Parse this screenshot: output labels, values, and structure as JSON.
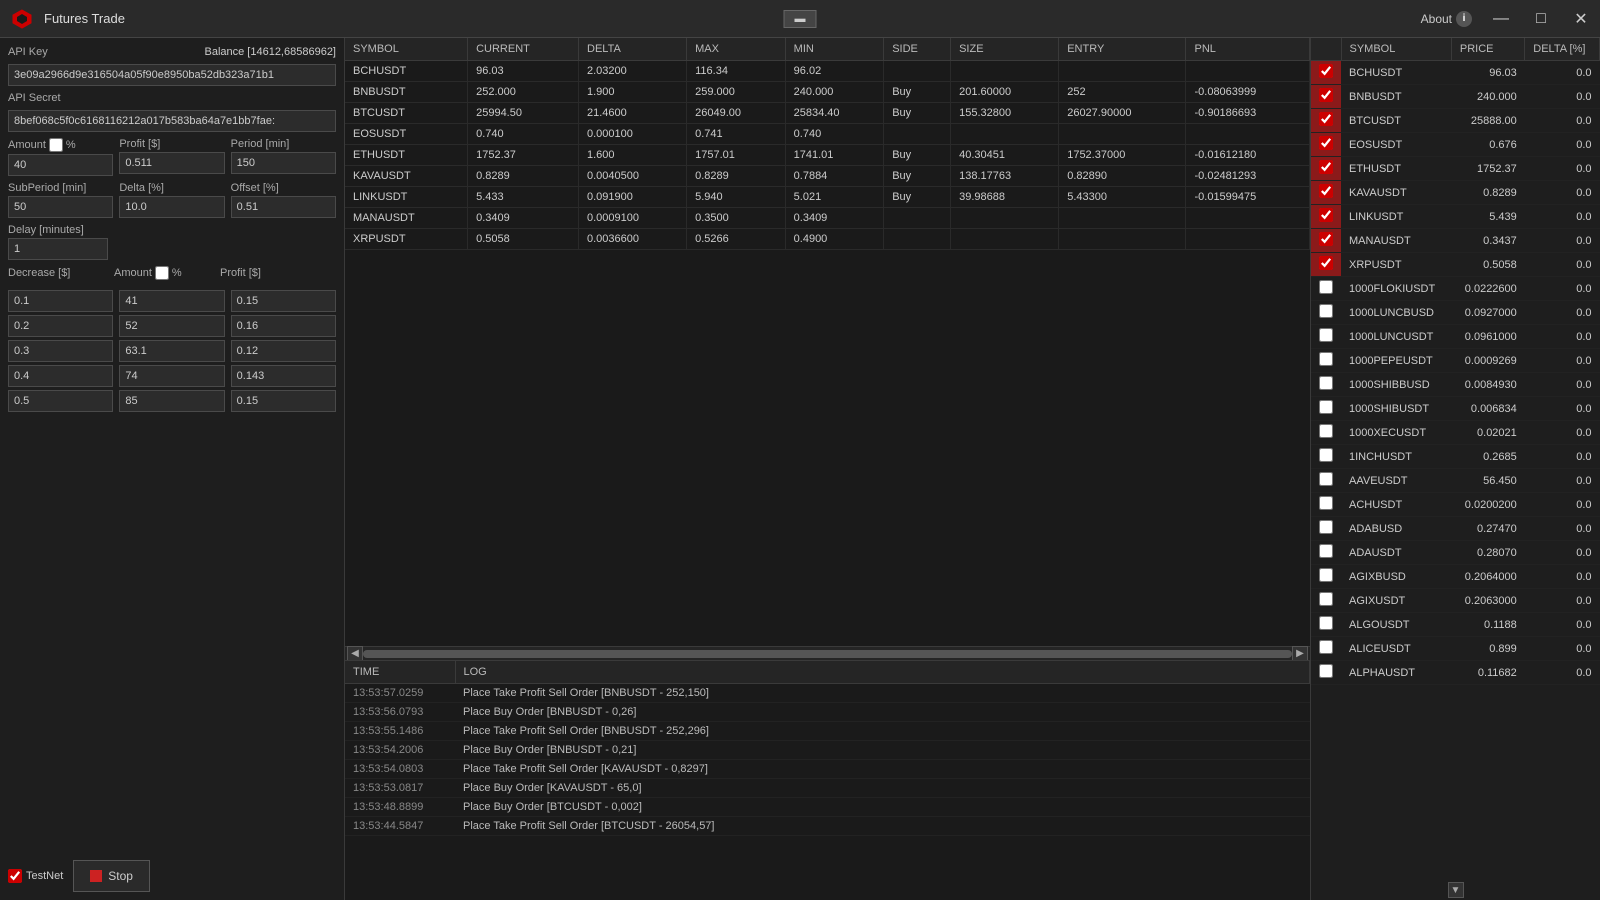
{
  "titlebar": {
    "logo": "◆",
    "title": "Futures Trade",
    "center_btn": "▬",
    "about_label": "About",
    "about_icon": "i",
    "minimize": "—",
    "restore": "□",
    "close": "✕"
  },
  "left": {
    "api_key_label": "API Key",
    "balance_label": "Balance [14612,68586962]",
    "api_key_value": "3e09a2966d9e316504a05f90e8950ba52db323a71b1",
    "api_secret_label": "API Secret",
    "api_secret_value": "8bef068c5f0c6168116212a017b583ba64a7e1bb7fae:",
    "amount_label": "Amount",
    "amount_has_checkbox": true,
    "amount_percent_label": "%",
    "amount_value": "40",
    "profit_label": "Profit [$]",
    "profit_value": "0.511",
    "period_label": "Period [min]",
    "period_value": "150",
    "subperiod_label": "SubPeriod [min]",
    "subperiod_value": "50",
    "delta_label": "Delta [%]",
    "delta_value": "10.0",
    "offset_label": "Offset [%]",
    "offset_value": "0.51",
    "delay_label": "Delay [minutes]",
    "delay_value": "1",
    "decrease_header": "Decrease [$]",
    "amount_col_header": "Amount",
    "profit_col_header": "Profit [$]",
    "decrease_has_checkbox": false,
    "amount_has_checkbox2": true,
    "decrease_rows": [
      {
        "decrease": "0.1",
        "amount": "41",
        "profit": "0.15"
      },
      {
        "decrease": "0.2",
        "amount": "52",
        "profit": "0.16"
      },
      {
        "decrease": "0.3",
        "amount": "63.1",
        "profit": "0.12"
      },
      {
        "decrease": "0.4",
        "amount": "74",
        "profit": "0.143"
      },
      {
        "decrease": "0.5",
        "amount": "85",
        "profit": "0.15"
      }
    ],
    "testnet_label": "TestNet",
    "stop_label": "Stop"
  },
  "trade_table": {
    "columns": [
      "SYMBOL",
      "CURRENT",
      "DELTA",
      "MAX",
      "MIN",
      "SIDE",
      "SIZE",
      "ENTRY",
      "PNL"
    ],
    "rows": [
      {
        "symbol": "BCHUSDT",
        "current": "96.03",
        "delta": "2.03200",
        "max": "116.34",
        "min": "96.02",
        "side": "",
        "size": "",
        "entry": "",
        "pnl": ""
      },
      {
        "symbol": "BNBUSDT",
        "current": "252.000",
        "delta": "1.900",
        "max": "259.000",
        "min": "240.000",
        "side": "Buy",
        "size": "201.60000",
        "entry": "252",
        "pnl": "-0.08063999"
      },
      {
        "symbol": "BTCUSDT",
        "current": "25994.50",
        "delta": "21.4600",
        "max": "26049.00",
        "min": "25834.40",
        "side": "Buy",
        "size": "155.32800",
        "entry": "26027.90000",
        "pnl": "-0.90186693"
      },
      {
        "symbol": "EOSUSDT",
        "current": "0.740",
        "delta": "0.000100",
        "max": "0.741",
        "min": "0.740",
        "side": "",
        "size": "",
        "entry": "",
        "pnl": ""
      },
      {
        "symbol": "ETHUSDT",
        "current": "1752.37",
        "delta": "1.600",
        "max": "1757.01",
        "min": "1741.01",
        "side": "Buy",
        "size": "40.30451",
        "entry": "1752.37000",
        "pnl": "-0.01612180"
      },
      {
        "symbol": "KAVAUSDT",
        "current": "0.8289",
        "delta": "0.0040500",
        "max": "0.8289",
        "min": "0.7884",
        "side": "Buy",
        "size": "138.17763",
        "entry": "0.82890",
        "pnl": "-0.02481293"
      },
      {
        "symbol": "LINKUSDT",
        "current": "5.433",
        "delta": "0.091900",
        "max": "5.940",
        "min": "5.021",
        "side": "Buy",
        "size": "39.98688",
        "entry": "5.43300",
        "pnl": "-0.01599475"
      },
      {
        "symbol": "MANAUSDT",
        "current": "0.3409",
        "delta": "0.0009100",
        "max": "0.3500",
        "min": "0.3409",
        "side": "",
        "size": "",
        "entry": "",
        "pnl": ""
      },
      {
        "symbol": "XRPUSDT",
        "current": "0.5058",
        "delta": "0.0036600",
        "max": "0.5266",
        "min": "0.4900",
        "side": "",
        "size": "",
        "entry": "",
        "pnl": ""
      }
    ]
  },
  "log": {
    "col_time": "TIME",
    "col_log": "LOG",
    "rows": [
      {
        "time": "13:53:57.0259",
        "log": "Place Take Profit Sell Order [BNBUSDT - 252,150]"
      },
      {
        "time": "13:53:56.0793",
        "log": "Place Buy Order [BNBUSDT - 0,26]"
      },
      {
        "time": "13:53:55.1486",
        "log": "Place Take Profit Sell Order [BNBUSDT - 252,296]"
      },
      {
        "time": "13:53:54.2006",
        "log": "Place Buy Order [BNBUSDT - 0,21]"
      },
      {
        "time": "13:53:54.0803",
        "log": "Place Take Profit Sell Order [KAVAUSDT - 0,8297]"
      },
      {
        "time": "13:53:53.0817",
        "log": "Place Buy Order [KAVAUSDT - 65,0]"
      },
      {
        "time": "13:53:48.8899",
        "log": "Place Buy Order [BTCUSDT - 0,002]"
      },
      {
        "time": "13:53:44.5847",
        "log": "Place Take Profit Sell Order [BTCUSDT - 26054,57]"
      }
    ]
  },
  "right_panel": {
    "col_symbol": "SYMBOL",
    "col_price": "PRICE",
    "col_delta": "DELTA [%]",
    "rows": [
      {
        "symbol": "BCHUSDT",
        "price": "96.03",
        "delta": "0.0",
        "checked": true
      },
      {
        "symbol": "BNBUSDT",
        "price": "240.000",
        "delta": "0.0",
        "checked": true
      },
      {
        "symbol": "BTCUSDT",
        "price": "25888.00",
        "delta": "0.0",
        "checked": true
      },
      {
        "symbol": "EOSUSDT",
        "price": "0.676",
        "delta": "0.0",
        "checked": true
      },
      {
        "symbol": "ETHUSDT",
        "price": "1752.37",
        "delta": "0.0",
        "checked": true
      },
      {
        "symbol": "KAVAUSDT",
        "price": "0.8289",
        "delta": "0.0",
        "checked": true
      },
      {
        "symbol": "LINKUSDT",
        "price": "5.439",
        "delta": "0.0",
        "checked": true
      },
      {
        "symbol": "MANAUSDT",
        "price": "0.3437",
        "delta": "0.0",
        "checked": true
      },
      {
        "symbol": "XRPUSDT",
        "price": "0.5058",
        "delta": "0.0",
        "checked": true
      },
      {
        "symbol": "1000FLOKIUSDT",
        "price": "0.0222600",
        "delta": "0.0",
        "checked": false
      },
      {
        "symbol": "1000LUNCBUSD",
        "price": "0.0927000",
        "delta": "0.0",
        "checked": false
      },
      {
        "symbol": "1000LUNCUSDT",
        "price": "0.0961000",
        "delta": "0.0",
        "checked": false
      },
      {
        "symbol": "1000PEPEUSDT",
        "price": "0.0009269",
        "delta": "0.0",
        "checked": false
      },
      {
        "symbol": "1000SHIBBUSD",
        "price": "0.0084930",
        "delta": "0.0",
        "checked": false
      },
      {
        "symbol": "1000SHIBUSDT",
        "price": "0.006834",
        "delta": "0.0",
        "checked": false
      },
      {
        "symbol": "1000XECUSDT",
        "price": "0.02021",
        "delta": "0.0",
        "checked": false
      },
      {
        "symbol": "1INCHUSDT",
        "price": "0.2685",
        "delta": "0.0",
        "checked": false
      },
      {
        "symbol": "AAVEUSDT",
        "price": "56.450",
        "delta": "0.0",
        "checked": false
      },
      {
        "symbol": "ACHUSDT",
        "price": "0.0200200",
        "delta": "0.0",
        "checked": false
      },
      {
        "symbol": "ADABUSD",
        "price": "0.27470",
        "delta": "0.0",
        "checked": false
      },
      {
        "symbol": "ADAUSDT",
        "price": "0.28070",
        "delta": "0.0",
        "checked": false
      },
      {
        "symbol": "AGIXBUSD",
        "price": "0.2064000",
        "delta": "0.0",
        "checked": false
      },
      {
        "symbol": "AGIXUSDT",
        "price": "0.2063000",
        "delta": "0.0",
        "checked": false
      },
      {
        "symbol": "ALGOUSDT",
        "price": "0.1188",
        "delta": "0.0",
        "checked": false
      },
      {
        "symbol": "ALICEUSDT",
        "price": "0.899",
        "delta": "0.0",
        "checked": false
      },
      {
        "symbol": "ALPHAUSDT",
        "price": "0.11682",
        "delta": "0.0",
        "checked": false
      }
    ]
  }
}
